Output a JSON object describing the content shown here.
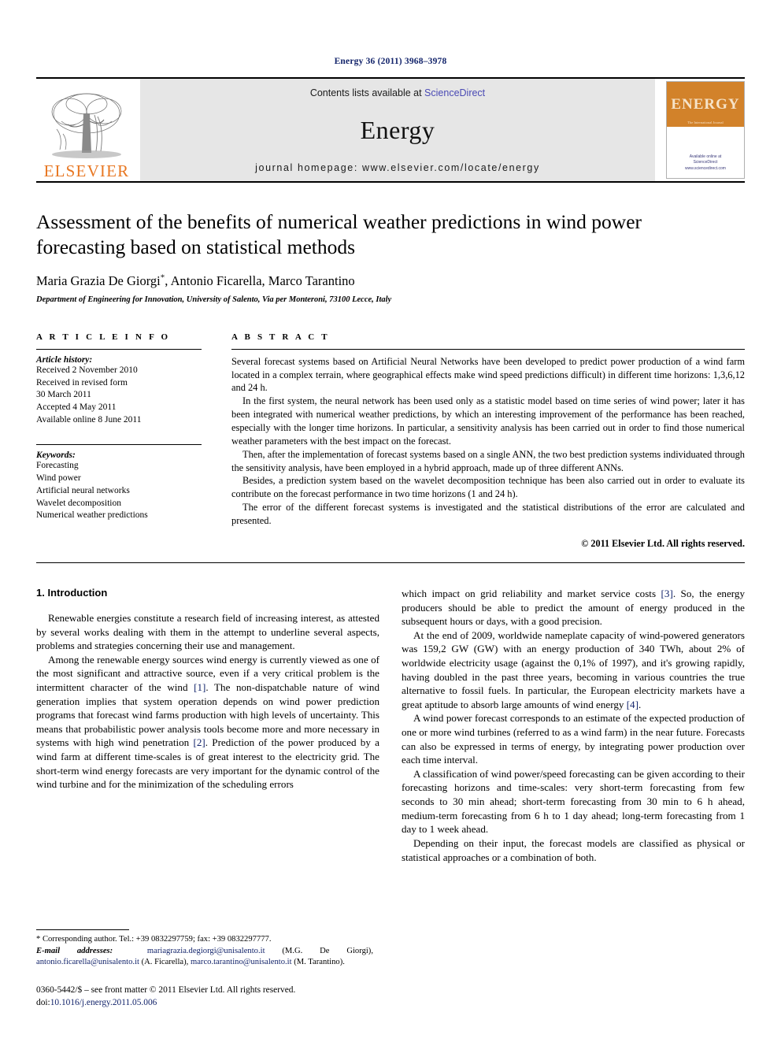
{
  "running_head": "Energy 36 (2011) 3968–3978",
  "masthead": {
    "publisher_logo_label": "ELSEVIER",
    "contents_prefix": "Contents lists available at ",
    "contents_link": "ScienceDirect",
    "journal_name": "Energy",
    "homepage_line": "journal homepage: www.elsevier.com/locate/energy",
    "cover": {
      "title": "ENERGY",
      "subtitle": "The International Journal",
      "footer_line_1": "Available online at",
      "footer_line_2": "ScienceDirect",
      "footer_line_3": "www.sciencedirect.com"
    }
  },
  "article": {
    "title": "Assessment of the benefits of numerical weather predictions in wind power forecasting based on statistical methods",
    "authors": "Maria Grazia De Giorgi, Antonio Ficarella, Marco Tarantino",
    "author_marker": "*",
    "affiliation": "Department of Engineering for Innovation, University of Salento, Via per Monteroni, 73100 Lecce, Italy"
  },
  "article_info": {
    "heading": "A R T I C L E   I N F O",
    "history_label": "Article history:",
    "history": [
      "Received 2 November 2010",
      "Received in revised form",
      "30 March 2011",
      "Accepted 4 May 2011",
      "Available online 8 June 2011"
    ],
    "keywords_label": "Keywords:",
    "keywords": [
      "Forecasting",
      "Wind power",
      "Artificial neural networks",
      "Wavelet decomposition",
      "Numerical weather predictions"
    ]
  },
  "abstract": {
    "heading": "A B S T R A C T",
    "paragraphs": [
      "Several forecast systems based on Artificial Neural Networks have been developed to predict power production of a wind farm located in a complex terrain, where geographical effects make wind speed predictions difficult) in different time horizons: 1,3,6,12 and 24 h.",
      "In the first system, the neural network has been used only as a statistic model based on time series of wind power; later it has been integrated with numerical weather predictions, by which an interesting improvement of the performance has been reached, especially with the longer time horizons. In particular, a sensitivity analysis has been carried out in order to find those numerical weather parameters with the best impact on the forecast.",
      "Then, after the implementation of forecast systems based on a single ANN, the two best prediction systems individuated through the sensitivity analysis, have been employed in a hybrid approach, made up of three different ANNs.",
      "Besides, a prediction system based on the wavelet decomposition technique has been also carried out in order to evaluate its contribute on the forecast performance in two time horizons (1 and 24 h).",
      "The error of the different forecast systems is investigated and the statistical distributions of the error are calculated and presented."
    ],
    "copyright": "© 2011 Elsevier Ltd. All rights reserved."
  },
  "body": {
    "section_title": "1. Introduction",
    "left_column": [
      "Renewable energies constitute a research field of increasing interest, as attested by several works dealing with them in the attempt to underline several aspects, problems and strategies concerning their use and management.",
      "Among the renewable energy sources wind energy is currently viewed as one of the most significant and attractive source, even if a very critical problem is the intermittent character of the wind [1]. The non-dispatchable nature of wind generation implies that system operation depends on wind power prediction programs that forecast wind farms production with high levels of uncertainty. This means that probabilistic power analysis tools become more and more necessary in systems with high wind penetration [2]. Prediction of the power produced by a wind farm at different time-scales is of great interest to the electricity grid. The short-term wind energy forecasts are very important for the dynamic control of the wind turbine and for the minimization of the scheduling errors"
    ],
    "right_column": [
      "which impact on grid reliability and market service costs [3]. So, the energy producers should be able to predict the amount of energy produced in the subsequent hours or days, with a good precision.",
      "At the end of 2009, worldwide nameplate capacity of wind-powered generators was 159,2 GW (GW) with an energy production of 340 TWh, about 2% of worldwide electricity usage (against the 0,1% of 1997), and it's growing rapidly, having doubled in the past three years, becoming in various countries the true alternative to fossil fuels. In particular, the European electricity markets have a great aptitude to absorb large amounts of wind energy [4].",
      "A wind power forecast corresponds to an estimate of the expected production of one or more wind turbines (referred to as a wind farm) in the near future. Forecasts can also be expressed in terms of energy, by integrating power production over each time interval.",
      "A classification of wind power/speed forecasting can be given according to their forecasting horizons and time-scales: very short-term forecasting from few seconds to 30 min ahead; short-term forecasting from 30 min to 6 h ahead, medium-term forecasting from 6 h to 1 day ahead; long-term forecasting from 1 day to 1 week ahead.",
      "Depending on their input, the forecast models are classified as physical or statistical approaches or a combination of both."
    ]
  },
  "footnotes": {
    "corresponding": "* Corresponding author. Tel.: +39 0832297759; fax: +39 0832297777.",
    "email_label": "E-mail addresses:",
    "email_1": "mariagrazia.degiorgi@unisalento.it",
    "email_1_name": " (M.G. De Giorgi), ",
    "email_2": "antonio.ficarella@unisalento.it",
    "email_2_name": " (A. Ficarella), ",
    "email_3": "marco.tarantino@unisalento.it",
    "email_3_name": " (M. Tarantino).",
    "issn_line": "0360-5442/$ – see front matter © 2011 Elsevier Ltd. All rights reserved.",
    "doi_label": "doi:",
    "doi_value": "10.1016/j.energy.2011.05.006"
  },
  "colors": {
    "link_blue": "#13246b",
    "sciencedirect_blue": "#4a4ab4",
    "elsevier_orange": "#e87722",
    "cover_orange": "#d2822a",
    "masthead_grey": "#e6e6e6"
  }
}
